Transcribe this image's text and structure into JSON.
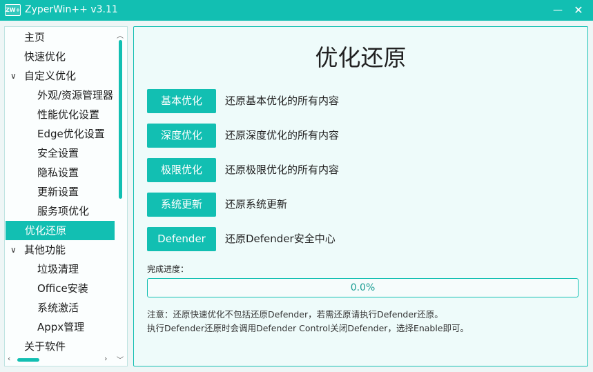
{
  "window": {
    "app_icon_text": "ZW+",
    "title": "ZyperWin++ v3.11",
    "minimize_symbol": "—",
    "close_symbol": "✕"
  },
  "sidebar": {
    "items": [
      {
        "label": "主页",
        "level": 0,
        "expandable": false,
        "selected": false
      },
      {
        "label": "快速优化",
        "level": 0,
        "expandable": false,
        "selected": false
      },
      {
        "label": "自定义优化",
        "level": 0,
        "expandable": true,
        "selected": false
      },
      {
        "label": "外观/资源管理器",
        "level": 1,
        "expandable": false,
        "selected": false
      },
      {
        "label": "性能优化设置",
        "level": 1,
        "expandable": false,
        "selected": false
      },
      {
        "label": "Edge优化设置",
        "level": 1,
        "expandable": false,
        "selected": false
      },
      {
        "label": "安全设置",
        "level": 1,
        "expandable": false,
        "selected": false
      },
      {
        "label": "隐私设置",
        "level": 1,
        "expandable": false,
        "selected": false
      },
      {
        "label": "更新设置",
        "level": 1,
        "expandable": false,
        "selected": false
      },
      {
        "label": "服务项优化",
        "level": 1,
        "expandable": false,
        "selected": false
      },
      {
        "label": "优化还原",
        "level": 0,
        "expandable": false,
        "selected": true
      },
      {
        "label": "其他功能",
        "level": 0,
        "expandable": true,
        "selected": false
      },
      {
        "label": "垃圾清理",
        "level": 1,
        "expandable": false,
        "selected": false
      },
      {
        "label": "Office安装",
        "level": 1,
        "expandable": false,
        "selected": false
      },
      {
        "label": "系统激活",
        "level": 1,
        "expandable": false,
        "selected": false
      },
      {
        "label": "Appx管理",
        "level": 1,
        "expandable": false,
        "selected": false
      },
      {
        "label": "关于软件",
        "level": 0,
        "expandable": false,
        "selected": false
      }
    ]
  },
  "main": {
    "title": "优化还原",
    "options": [
      {
        "button": "基本优化",
        "description": "还原基本优化的所有内容"
      },
      {
        "button": "深度优化",
        "description": "还原深度优化的所有内容"
      },
      {
        "button": "极限优化",
        "description": "还原极限优化的所有内容"
      },
      {
        "button": "系统更新",
        "description": "还原系统更新"
      },
      {
        "button": "Defender",
        "description": "还原Defender安全中心"
      }
    ],
    "progress_label": "完成进度：",
    "progress_value": 0.0,
    "progress_text": "0.0%",
    "notes": [
      "注意：还原快速优化不包括还原Defender，若需还原请执行Defender还原。",
      "执行Defender还原时会调用Defender Control关闭Defender，选择Enable即可。"
    ]
  },
  "colors": {
    "accent": "#12bfb2",
    "panel_bg": "#eefbfa",
    "text": "#222222"
  }
}
